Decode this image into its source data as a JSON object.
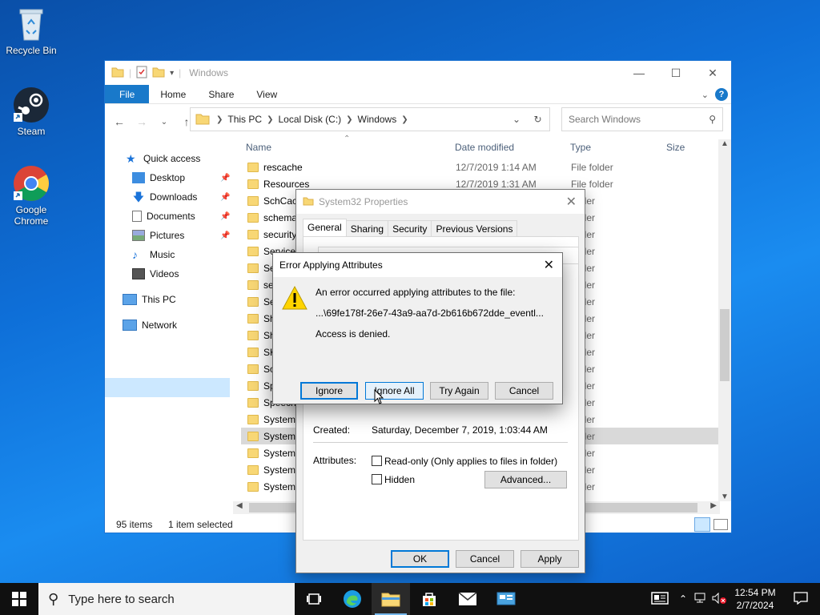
{
  "desktop": {
    "icons": [
      {
        "label": "Recycle Bin",
        "icon": "recycle-bin-icon"
      },
      {
        "label": "Steam",
        "icon": "steam-icon"
      },
      {
        "label": "Google Chrome",
        "icon": "chrome-icon"
      }
    ]
  },
  "explorer": {
    "title": "Windows",
    "ribbon_tabs": [
      "File",
      "Home",
      "Share",
      "View"
    ],
    "breadcrumb": [
      "This PC",
      "Local Disk (C:)",
      "Windows"
    ],
    "search_placeholder": "Search Windows",
    "columns": [
      "Name",
      "Date modified",
      "Type",
      "Size"
    ],
    "nav": {
      "quick_access": "Quick access",
      "items": [
        "Desktop",
        "Downloads",
        "Documents",
        "Pictures",
        "Music",
        "Videos"
      ],
      "this_pc": "This PC",
      "network": "Network"
    },
    "files": [
      {
        "name": "rescache",
        "date": "12/7/2019 1:14 AM",
        "type": "File folder"
      },
      {
        "name": "Resources",
        "date": "12/7/2019 1:31 AM",
        "type": "File folder"
      },
      {
        "name": "SchCac",
        "date": "",
        "type": "folder"
      },
      {
        "name": "schema",
        "date": "",
        "type": "folder"
      },
      {
        "name": "security",
        "date": "",
        "type": "folder"
      },
      {
        "name": "ServiceP",
        "date": "",
        "type": "folder"
      },
      {
        "name": "Se",
        "date": "",
        "type": "folder"
      },
      {
        "name": "se",
        "date": "",
        "type": "folder"
      },
      {
        "name": "Se",
        "date": "",
        "type": "folder"
      },
      {
        "name": "Sh",
        "date": "",
        "type": "folder"
      },
      {
        "name": "Sh",
        "date": "",
        "type": "folder"
      },
      {
        "name": "SK",
        "date": "",
        "type": "folder"
      },
      {
        "name": "So",
        "date": "",
        "type": "folder"
      },
      {
        "name": "Sp",
        "date": "",
        "type": "folder"
      },
      {
        "name": "Speech",
        "date": "",
        "type": "folder"
      },
      {
        "name": "System",
        "date": "",
        "type": "folder"
      },
      {
        "name": "System3",
        "date": "",
        "type": "folder",
        "selected": true
      },
      {
        "name": "SystemA",
        "date": "",
        "type": "folder"
      },
      {
        "name": "SystemR",
        "date": "",
        "type": "folder"
      },
      {
        "name": "SystemT",
        "date": "",
        "type": "folder"
      }
    ],
    "status": {
      "count": "95 items",
      "selected": "1 item selected"
    }
  },
  "properties": {
    "title": "System32 Properties",
    "tabs": [
      "General",
      "Sharing",
      "Security",
      "Previous Versions"
    ],
    "created_label": "Created:",
    "created_value": "Saturday, December 7, 2019, 1:03:44 AM",
    "attributes_label": "Attributes:",
    "readonly_label": "Read-only (Only applies to files in folder)",
    "hidden_label": "Hidden",
    "advanced_label": "Advanced...",
    "ok": "OK",
    "cancel": "Cancel",
    "apply": "Apply"
  },
  "error_dialog": {
    "title": "Error Applying Attributes",
    "message": "An error occurred applying attributes to the file:",
    "path": "...\\69fe178f-26e7-43a9-aa7d-2b616b672dde_eventl...",
    "detail": "Access is denied.",
    "buttons": {
      "ignore": "Ignore",
      "ignore_all": "Ignore All",
      "try_again": "Try Again",
      "cancel": "Cancel"
    }
  },
  "taskbar": {
    "search_placeholder": "Type here to search",
    "time": "12:54 PM",
    "date": "2/7/2024"
  }
}
